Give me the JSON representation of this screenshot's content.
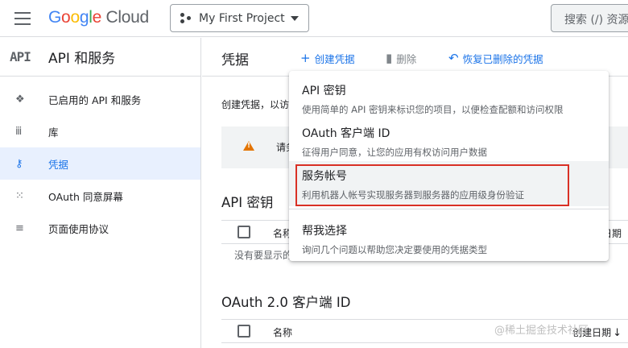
{
  "topbar": {
    "logo_google": "Google",
    "logo_cloud": "Cloud",
    "project_name": "My First Project",
    "search_placeholder": "搜索 (/) 资源"
  },
  "sidebar": {
    "logo": "API",
    "title": "API 和服务",
    "items": [
      {
        "label": "已启用的 API 和服务",
        "icon": "diamond-dots-icon",
        "glyph": "❖"
      },
      {
        "label": "库",
        "icon": "library-grid-icon",
        "glyph": "ⅲ"
      },
      {
        "label": "凭据",
        "icon": "key-icon",
        "glyph": "⚷"
      },
      {
        "label": "OAuth 同意屏幕",
        "icon": "dots-icon",
        "glyph": "⁙"
      },
      {
        "label": "页面使用协议",
        "icon": "settings-list-icon",
        "glyph": "≡"
      }
    ],
    "active_index": 2
  },
  "main": {
    "title": "凭据",
    "actions": {
      "create": "创建凭据",
      "delete": "删除",
      "restore": "恢复已删除的凭据"
    },
    "intro": "创建凭据，以访",
    "warning": "请务",
    "api_keys": {
      "title": "API 密钥",
      "col_name": "名称",
      "col_date": "创建日期",
      "empty": "没有要显示的"
    },
    "oauth": {
      "title": "OAuth 2.0 客户端 ID",
      "col_name": "名称",
      "col_date": "创建日期"
    }
  },
  "dropdown": {
    "items": [
      {
        "title": "API 密钥",
        "desc": "使用简单的 API 密钥来标识您的项目，以便检查配额和访问权限"
      },
      {
        "title": "OAuth 客户端 ID",
        "desc": "征得用户同意，让您的应用有权访问用户数据"
      },
      {
        "title": "服务帐号",
        "desc": "利用机器人帐号实现服务器到服务器的应用级身份验证"
      },
      {
        "title": "帮我选择",
        "desc": "询问几个问题以帮助您决定要使用的凭据类型"
      }
    ]
  },
  "watermark": "@稀土掘金技术社区",
  "colors": {
    "accent": "#1a73e8",
    "highlight_border": "#d93025",
    "warning": "#e37400"
  }
}
